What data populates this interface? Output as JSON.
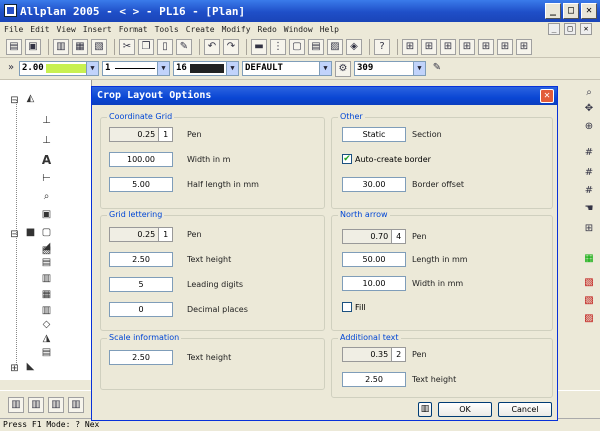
{
  "window": {
    "title": "Allplan 2005 - <      > - PL16 - [Plan]",
    "minimize": "_",
    "restore": "□",
    "close": "✕"
  },
  "menu": [
    "File",
    "Edit",
    "View",
    "Insert",
    "Format",
    "Tools",
    "Create",
    "Modify",
    "Redo",
    "Window",
    "Help"
  ],
  "format_bar": {
    "pen_thickness": "2.00",
    "line_type": "1",
    "color": "16",
    "layer": "DEFAULT",
    "hatch": "309"
  },
  "status": "Press F1 Mode: ? Nex",
  "dialog": {
    "title": "Crop Layout Options",
    "close": "✕",
    "coordinate_grid": {
      "label": "Coordinate Grid",
      "pen_value": "0.25",
      "pen_number": "1",
      "pen_label": "Pen",
      "width_value": "100.00",
      "width_label": "Width in m",
      "half_length_value": "5.00",
      "half_length_label": "Half length in mm"
    },
    "grid_lettering": {
      "label": "Grid lettering",
      "pen_value": "0.25",
      "pen_number": "1",
      "pen_label": "Pen",
      "text_height_value": "2.50",
      "text_height_label": "Text height",
      "leading_digits_value": "5",
      "leading_digits_label": "Leading digits",
      "decimal_places_value": "0",
      "decimal_places_label": "Decimal places"
    },
    "scale_information": {
      "label": "Scale information",
      "text_height_value": "2.50",
      "text_height_label": "Text height"
    },
    "other": {
      "label": "Other",
      "section_button": "Static",
      "section_label": "Section",
      "auto_border_checked": true,
      "auto_border_label": "Auto-create border",
      "border_offset_value": "30.00",
      "border_offset_label": "Border offset"
    },
    "north_arrow": {
      "label": "North arrow",
      "pen_value": "0.70",
      "pen_number": "4",
      "pen_label": "Pen",
      "length_value": "50.00",
      "length_label": "Length in mm",
      "width_value": "10.00",
      "width_label": "Width in mm",
      "fill_checked": false,
      "fill_label": "Fill"
    },
    "additional_text": {
      "label": "Additional text",
      "pen_value": "0.35",
      "pen_number": "2",
      "pen_label": "Pen",
      "text_height_value": "2.50",
      "text_height_label": "Text height"
    },
    "buttons": {
      "ok": "OK",
      "cancel": "Cancel"
    },
    "check_mark": "✔"
  },
  "colors": {
    "title_blue": "#1F4FC8",
    "group_label": "#0046D5",
    "pen_swatch": "#C8F050"
  }
}
